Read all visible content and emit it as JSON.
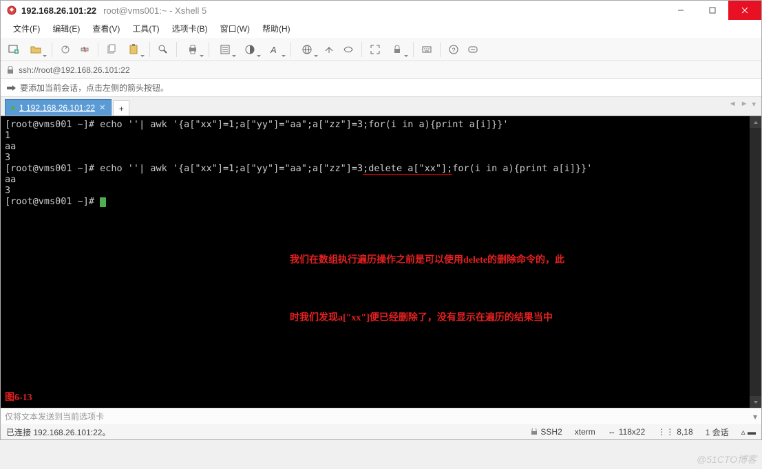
{
  "title": {
    "ip": "192.168.26.101:22",
    "subtitle": "root@vms001:~ - Xshell 5"
  },
  "menu": {
    "file": "文件(F)",
    "edit": "编辑(E)",
    "view": "查看(V)",
    "tools": "工具(T)",
    "tabs": "选项卡(B)",
    "window": "窗口(W)",
    "help": "帮助(H)"
  },
  "address": {
    "url": "ssh://root@192.168.26.101:22"
  },
  "hint": {
    "text": "要添加当前会话，点击左侧的箭头按钮。"
  },
  "tab": {
    "label": "1 192.168.26.101:22"
  },
  "terminal": {
    "lines": [
      "[root@vms001 ~]# echo ''| awk '{a[\"xx\"]=1;a[\"yy\"]=\"aa\";a[\"zz\"]=3;for(i in a){print a[i]}}'",
      "1",
      "aa",
      "3"
    ],
    "line2_prefix": "[root@vms001 ~]# echo ''| awk '{a[\"xx\"]=1;a[\"yy\"]=\"aa\";a[\"zz\"]=3",
    "line2_underlined": ";delete a[\"xx\"];",
    "line2_suffix": "for(i in a){print a[i]}}'",
    "lines_after": [
      "aa",
      "3"
    ],
    "prompt_final": "[root@vms001 ~]# ",
    "annotation_line1": "我们在数组执行遍历操作之前是可以使用delete的删除命令的，此",
    "annotation_line2": "时我们发现a[\"xx\"]便已经删除了，没有显示在遍历的结果当中",
    "figure_label": "图6-13"
  },
  "sendbar": {
    "placeholder": "仅将文本发送到当前选项卡"
  },
  "status": {
    "connected": "已连接 192.168.26.101:22。",
    "proto": "SSH2",
    "term": "xterm",
    "size": "118x22",
    "pos": "8,18",
    "sessions": "1 会话"
  },
  "watermark": "@51CTO博客"
}
